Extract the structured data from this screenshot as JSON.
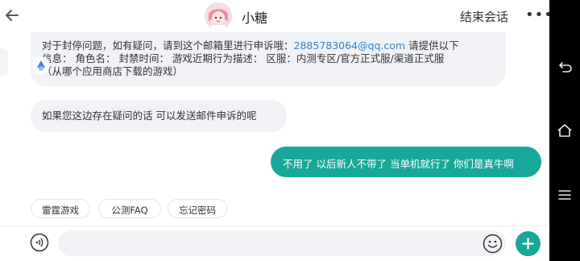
{
  "header": {
    "title": "小糖",
    "end_chat_label": "结束会话",
    "more_label": "•••"
  },
  "messages": {
    "system_line1_prefix": "对于封停问题，如有疑问，请到这个邮箱里进行申诉哦：",
    "system_email": "2885783064@qq.com",
    "system_line1_suffix": " 请提供以下",
    "system_line2": "信息：  角色名：  封禁时间：  游戏近期行为描述：  区服：内测专区/官方正式服/渠道正式服",
    "system_line3": "（从哪个应用商店下载的游戏）",
    "agent_reply": "如果您这边存在疑问的话 可以发送邮件申诉的呢",
    "user_reply": "不用了 以后新人不带了 当单机就行了 你们是真牛啊"
  },
  "quick_replies": [
    "雷霆游戏",
    "公测FAQ",
    "忘记密码"
  ],
  "input": {
    "placeholder": ""
  },
  "colors": {
    "accent": "#17a89b",
    "link": "#2f86c9",
    "bubble": "#f1f2f6"
  },
  "icons": {
    "back": "arrow-left-icon",
    "voice": "voice-icon",
    "emoji": "smiley-icon",
    "plus": "plus-icon",
    "nav_back": "android-back-icon",
    "nav_home": "android-home-icon",
    "nav_menu": "android-menu-icon"
  }
}
